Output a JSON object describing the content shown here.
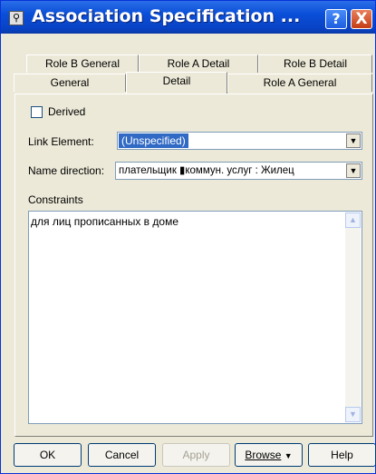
{
  "window": {
    "title": "Association Specification ...",
    "help_glyph": "?",
    "close_glyph": "X"
  },
  "tabs": {
    "row_back": [
      {
        "label": "Role B General"
      },
      {
        "label": "Role A Detail"
      },
      {
        "label": "Role B Detail"
      }
    ],
    "row_front": [
      {
        "label": "General"
      },
      {
        "label": "Detail",
        "active": true
      },
      {
        "label": "Role A General"
      }
    ]
  },
  "form": {
    "derived_label": "Derived",
    "derived_checked": false,
    "link_element_label": "Link Element:",
    "link_element_value": "(Unspecified)",
    "name_direction_label": "Name direction:",
    "name_direction_value": "плательщик ▮коммун. услуг : Жилец",
    "constraints_label": "Constraints",
    "constraints_value": "для лиц прописанных в доме"
  },
  "buttons": {
    "ok": "OK",
    "cancel": "Cancel",
    "apply": "Apply",
    "browse": "Browse",
    "browse_arrow": "▼",
    "help": "Help"
  },
  "icons": {
    "app": "app-icon",
    "dropdown": "chevron-down-icon",
    "scroll_up": "scroll-up-arrow-icon",
    "scroll_down": "scroll-down-arrow-icon"
  },
  "colors": {
    "titlebar": "#0a4fd8",
    "selection": "#316ac5",
    "dialog_bg": "#ece9d8",
    "close_button": "#c43c14"
  }
}
